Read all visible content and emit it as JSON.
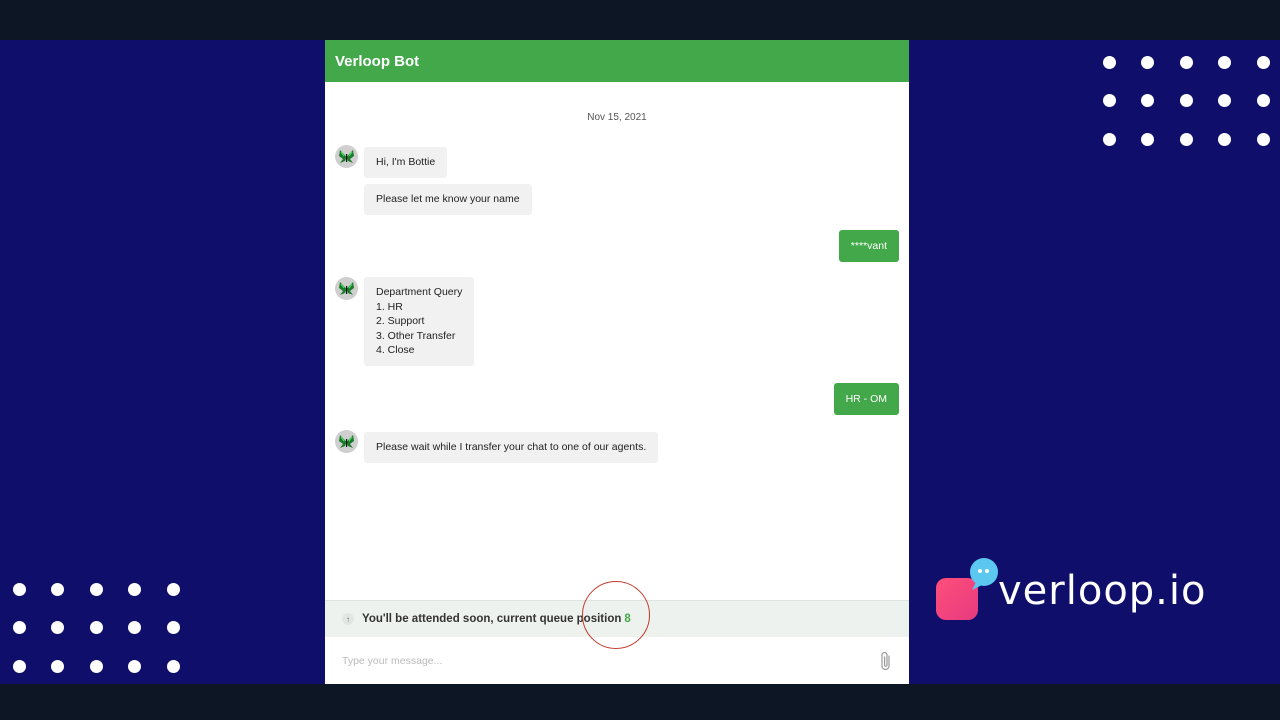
{
  "header": {
    "title": "Verloop Bot"
  },
  "chat": {
    "date": "Nov 15, 2021",
    "messages": [
      {
        "from": "bot",
        "text": "Hi, I'm Bottie"
      },
      {
        "from": "bot",
        "text": "Please let me know your name"
      },
      {
        "from": "user",
        "text": "****vant"
      },
      {
        "from": "bot",
        "lines": [
          "Department Query",
          "1. HR",
          "2. Support",
          "3. Other Transfer",
          "4. Close"
        ]
      },
      {
        "from": "user",
        "text": "HR - OM"
      },
      {
        "from": "bot",
        "text": "Please wait while I transfer your chat to one of our agents."
      }
    ]
  },
  "queue": {
    "text": "You'll be attended soon, current queue position",
    "position": "8",
    "icon": "arrow-up-icon"
  },
  "composer": {
    "placeholder": "Type your message...",
    "attach_icon": "paperclip-icon"
  },
  "brand": {
    "logo_text": "verloop.io",
    "accent_green": "#43a84a",
    "background": "#0f0f6b"
  }
}
